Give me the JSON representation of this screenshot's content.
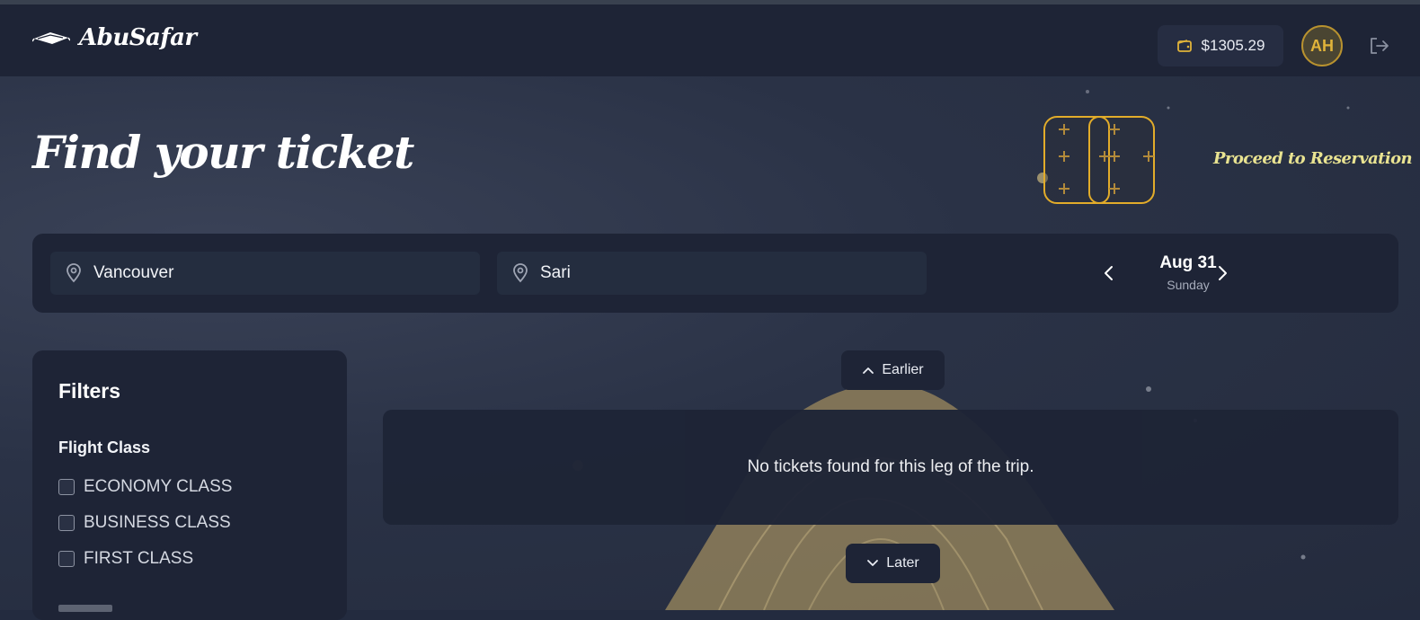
{
  "navbar": {
    "brand_name": "AbuSafar",
    "wallet_balance": "$1305.29",
    "avatar_initials": "AH"
  },
  "page": {
    "title": "Find your ticket",
    "proceed_label": "Proceed to Reservation"
  },
  "search": {
    "origin_value": "Vancouver",
    "destination_value": "Sari",
    "date_label": "Aug 31",
    "day_label": "Sunday"
  },
  "filters": {
    "title": "Filters",
    "flight_class_heading": "Flight Class",
    "options": [
      {
        "label": "ECONOMY CLASS",
        "checked": false
      },
      {
        "label": "BUSINESS CLASS",
        "checked": false
      },
      {
        "label": "FIRST CLASS",
        "checked": false
      }
    ]
  },
  "results": {
    "earlier_label": "Earlier",
    "later_label": "Later",
    "empty_message": "No tickets found for this leg of the trip."
  },
  "icons": {
    "brand": "flying-carpet-icon",
    "wallet": "wallet-icon",
    "logout": "logout-icon",
    "location": "map-pin-icon",
    "prev": "chevron-left-icon",
    "next": "chevron-right-icon",
    "up": "chevron-up-icon",
    "down": "chevron-down-icon",
    "ticket": "ticket-icon"
  },
  "colors": {
    "gold_accent": "#e0b33a",
    "proceed_text": "#e9e391",
    "panel_bg": "#1e2436"
  }
}
